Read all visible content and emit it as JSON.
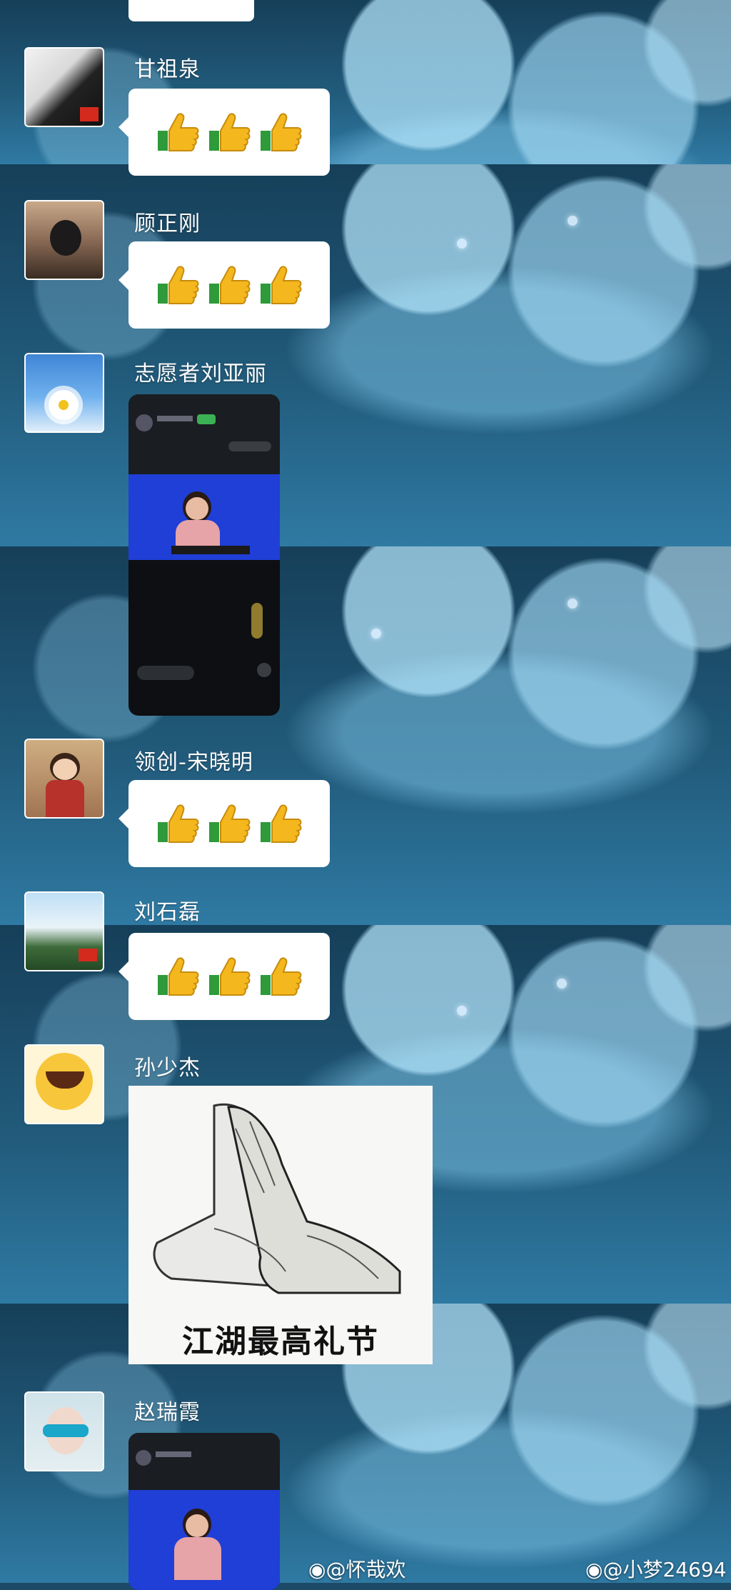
{
  "messages": [
    {
      "sender": "甘祖泉",
      "content": "thumbs-up-x3"
    },
    {
      "sender": "顾正刚",
      "content": "thumbs-up-x3"
    },
    {
      "sender": "志愿者刘亚丽",
      "content": "live-stream-screenshot"
    },
    {
      "sender": "领创-宋晓明",
      "content": "thumbs-up-x3"
    },
    {
      "sender": "刘石磊",
      "content": "thumbs-up-x3"
    },
    {
      "sender": "孙少杰",
      "content": "meme-image",
      "meme_caption": "江湖最高礼节"
    },
    {
      "sender": "赵瑞霞",
      "content": "live-stream-screenshot"
    }
  ],
  "watermarks": [
    "@怀哉欢",
    "@小梦24694"
  ],
  "icons": [
    "thumbs-up-icon",
    "weibo-icon",
    "avatar"
  ],
  "colors": {
    "bubble": "#ffffff",
    "background": "#1d4a66",
    "accent_blue": "#1f3fd6"
  }
}
